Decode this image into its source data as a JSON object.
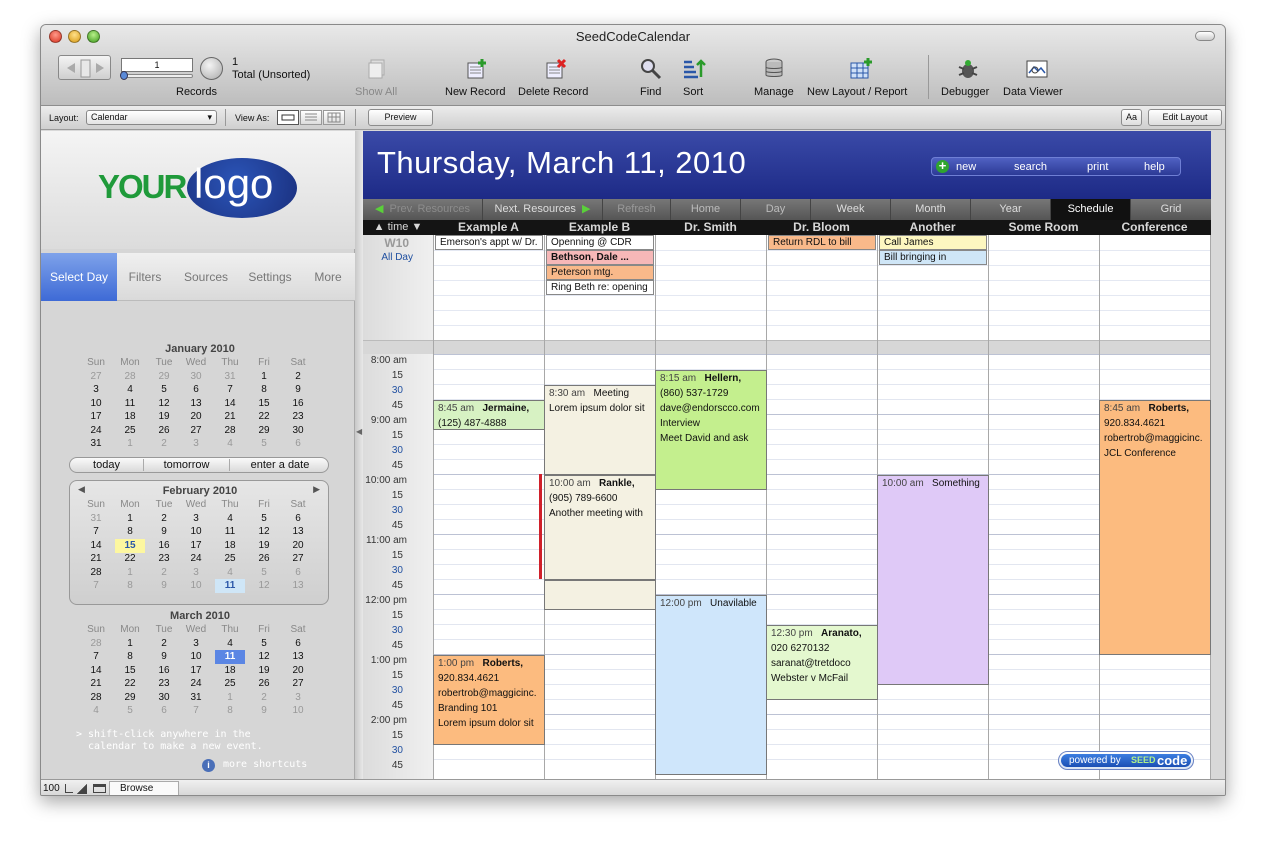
{
  "window": {
    "title": "SeedCodeCalendar"
  },
  "toolbar": {
    "record_number": "1",
    "record_count": "1",
    "record_status": "Total (Unsorted)",
    "records_label": "Records",
    "show_all": "Show All",
    "new_record": "New Record",
    "delete_record": "Delete Record",
    "find": "Find",
    "sort": "Sort",
    "manage": "Manage",
    "new_layout": "New Layout / Report",
    "debugger": "Debugger",
    "data_viewer": "Data Viewer"
  },
  "layoutbar": {
    "layout_label": "Layout:",
    "layout_value": "Calendar",
    "view_as_label": "View As:",
    "preview": "Preview",
    "aa": "Aa",
    "edit_layout": "Edit Layout"
  },
  "sidebar": {
    "logo_your": "YOUR",
    "logo_logo": "logo",
    "tabs": [
      "Select Day",
      "Filters",
      "Sources",
      "Settings",
      "More"
    ],
    "quick": [
      "today",
      "tomorrow",
      "enter a date"
    ],
    "weekdays": [
      "Sun",
      "Mon",
      "Tue",
      "Wed",
      "Thu",
      "Fri",
      "Sat"
    ],
    "months": [
      {
        "title": "January 2010",
        "weeks": [
          [
            "27",
            "28",
            "29",
            "30",
            "31",
            "1",
            "2"
          ],
          [
            "3",
            "4",
            "5",
            "6",
            "7",
            "8",
            "9"
          ],
          [
            "10",
            "11",
            "12",
            "13",
            "14",
            "15",
            "16"
          ],
          [
            "17",
            "18",
            "19",
            "20",
            "21",
            "22",
            "23"
          ],
          [
            "24",
            "25",
            "26",
            "27",
            "28",
            "29",
            "30"
          ],
          [
            "31",
            "1",
            "2",
            "3",
            "4",
            "5",
            "6"
          ]
        ]
      },
      {
        "title": "February 2010",
        "weeks": [
          [
            "31",
            "1",
            "2",
            "3",
            "4",
            "5",
            "6"
          ],
          [
            "7",
            "8",
            "9",
            "10",
            "11",
            "12",
            "13"
          ],
          [
            "14",
            "15",
            "16",
            "17",
            "18",
            "19",
            "20"
          ],
          [
            "21",
            "22",
            "23",
            "24",
            "25",
            "26",
            "27"
          ],
          [
            "28",
            "1",
            "2",
            "3",
            "4",
            "5",
            "6"
          ],
          [
            "7",
            "8",
            "9",
            "10",
            "11",
            "12",
            "13"
          ]
        ]
      },
      {
        "title": "March 2010",
        "weeks": [
          [
            "28",
            "1",
            "2",
            "3",
            "4",
            "5",
            "6"
          ],
          [
            "7",
            "8",
            "9",
            "10",
            "11",
            "12",
            "13"
          ],
          [
            "14",
            "15",
            "16",
            "17",
            "18",
            "19",
            "20"
          ],
          [
            "21",
            "22",
            "23",
            "24",
            "25",
            "26",
            "27"
          ],
          [
            "28",
            "29",
            "30",
            "31",
            "1",
            "2",
            "3"
          ],
          [
            "4",
            "5",
            "6",
            "7",
            "8",
            "9",
            "10"
          ]
        ]
      }
    ],
    "hint": "> shift-click anywhere in the\n  calendar to make a new event.",
    "more_shortcuts": "more shortcuts"
  },
  "header": {
    "date": "Thursday, March 11, 2010",
    "actions": [
      "new",
      "search",
      "print",
      "help"
    ]
  },
  "nav": [
    "Prev. Resources",
    "Next. Resources",
    "Refresh",
    "Home",
    "Day",
    "Week",
    "Month",
    "Year",
    "Schedule",
    "Grid"
  ],
  "columns": {
    "time_label": "time",
    "resources": [
      "Example A",
      "Example B",
      "Dr. Smith",
      "Dr. Bloom",
      "Another",
      "Some Room",
      "Conference"
    ]
  },
  "allday": {
    "week": "W10",
    "label": "All Day",
    "items": [
      {
        "col": 0,
        "row": 0,
        "text": "Emerson's appt w/ Dr.",
        "color": "#ffffff"
      },
      {
        "col": 1,
        "row": 0,
        "text": "Openning @ CDR",
        "color": "#ffffff"
      },
      {
        "col": 1,
        "row": 1,
        "text": "Bethson, Dale ...",
        "color": "#f6b8b8",
        "bold": true
      },
      {
        "col": 1,
        "row": 2,
        "text": "Peterson mtg.",
        "color": "#f9b98a"
      },
      {
        "col": 1,
        "row": 3,
        "text": "Ring Beth re: opening",
        "color": "#ffffff"
      },
      {
        "col": 3,
        "row": 0,
        "text": "Return RDL to bill",
        "color": "#f9b98a"
      },
      {
        "col": 4,
        "row": 0,
        "text": "Call James",
        "color": "#fdf7c0"
      },
      {
        "col": 4,
        "row": 1,
        "text": "Bill bringing in",
        "color": "#cfe6f7"
      }
    ]
  },
  "times": [
    "8:00 am",
    "15",
    "30",
    "45",
    "9:00 am",
    "15",
    "30",
    "45",
    "10:00 am",
    "15",
    "30",
    "45",
    "11:00 am",
    "15",
    "30",
    "45",
    "12:00 pm",
    "15",
    "30",
    "45",
    "1:00 pm",
    "15",
    "30",
    "45",
    "2:00 pm",
    "15",
    "30",
    "45"
  ],
  "events": [
    {
      "col": 0,
      "start": 3,
      "len": 2,
      "color": "#d7f2c3",
      "time": "8:45 am",
      "title": "Jermaine,",
      "lines": [
        "(125) 487-4888"
      ]
    },
    {
      "col": 1,
      "start": 2,
      "len": 6,
      "color": "#f4f1e2",
      "time": "8:30 am",
      "title": "Meeting",
      "title_bold": false,
      "lines": [
        "Lorem ipsum dolor sit"
      ]
    },
    {
      "col": 2,
      "start": 1,
      "len": 8,
      "color": "#c4ef8e",
      "time": "8:15 am",
      "title": "Hellern,",
      "lines": [
        "(860) 537-1729",
        "dave@endorscco.com",
        "Interview",
        "Meet David and ask"
      ]
    },
    {
      "col": 6,
      "start": 3,
      "len": 17,
      "color": "#fcbb7f",
      "time": "8:45 am",
      "title": "Roberts,",
      "lines": [
        "920.834.4621",
        "robertrob@maggicinc.",
        "JCL Conference"
      ]
    },
    {
      "col": 1,
      "start": 8,
      "len": 7,
      "color": "#f4f1e2",
      "time": "10:00 am",
      "title": "Rankle,",
      "lines": [
        "(905) 789-6600",
        "Another meeting with"
      ]
    },
    {
      "col": 4,
      "start": 8,
      "len": 14,
      "color": "#dfc9f7",
      "time": "10:00 am",
      "title": "Something",
      "title_bold": false,
      "lines": []
    },
    {
      "col": 1,
      "start": 15,
      "len": 2,
      "color": "#f4f1e2",
      "time": "",
      "title": "",
      "lines": []
    },
    {
      "col": 2,
      "start": 16,
      "len": 12,
      "color": "#cfe6fb",
      "time": "12:00 pm",
      "title": "Unavilable",
      "title_bold": false,
      "lines": []
    },
    {
      "col": 3,
      "start": 18,
      "len": 5,
      "color": "#e4f8cf",
      "time": "12:30 pm",
      "title": "Aranato,",
      "lines": [
        "020 6270132",
        "saranat@tretdoco",
        "Webster v McFail"
      ]
    },
    {
      "col": 0,
      "start": 20,
      "len": 6,
      "color": "#fcbb7f",
      "time": "1:00 pm",
      "title": "Roberts,",
      "lines": [
        "920.834.4621",
        "robertrob@maggicinc.",
        "Branding 101",
        "Lorem ipsum dolor sit"
      ]
    }
  ],
  "status": {
    "zoom": "100",
    "mode": "Browse"
  },
  "powered": {
    "prefix": "powered by",
    "seed": "SEED",
    "code": "code"
  },
  "colors": {
    "header": "#1d2a86",
    "accent": "#2e62d6",
    "today": "#5b86e4"
  }
}
